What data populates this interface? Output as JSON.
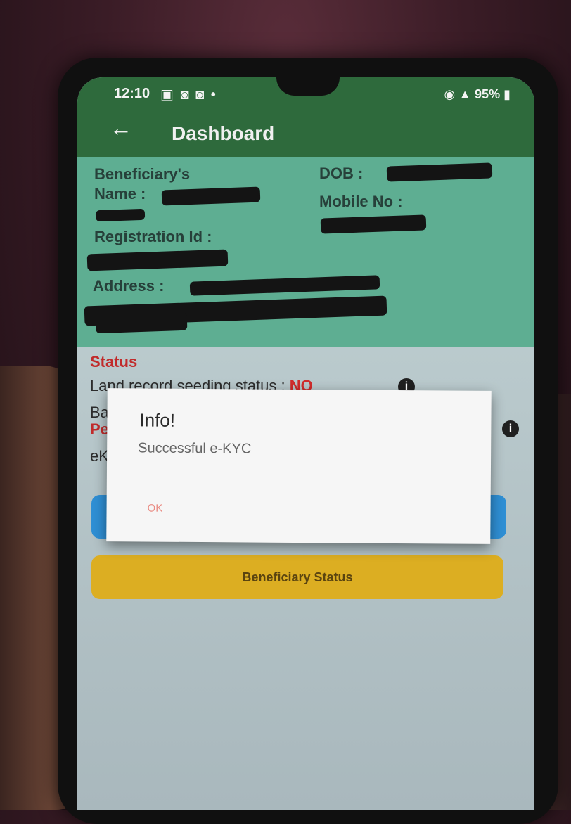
{
  "statusbar": {
    "time": "12:10",
    "notification_icons": "▣ ◙ ◙ •",
    "right": "95%"
  },
  "appbar": {
    "title": "Dashboard",
    "back_icon": "←"
  },
  "beneficiary": {
    "name_label": "Beneficiary's Name :",
    "dob_label": "DOB :",
    "mobile_label": "Mobile No :",
    "registration_label": "Registration Id :",
    "address_label": "Address :"
  },
  "status": {
    "title": "Status",
    "land_record_label": "Land record seeding status :",
    "land_record_value": "NO",
    "bank_fragment": "Ba",
    "pending_fragment": "Pe",
    "ekyc_fragment": "eK"
  },
  "buttons": {
    "beneficiary_status": "Beneficiary Status"
  },
  "dialog": {
    "title": "Info!",
    "message": "Successful e-KYC",
    "ok": "OK"
  },
  "colors": {
    "appbar": "#2e6a3c",
    "info_card": "#5eae92",
    "status_red": "#c12b2b",
    "primary_button": "#2f8fd4",
    "status_button": "#dcae22"
  }
}
